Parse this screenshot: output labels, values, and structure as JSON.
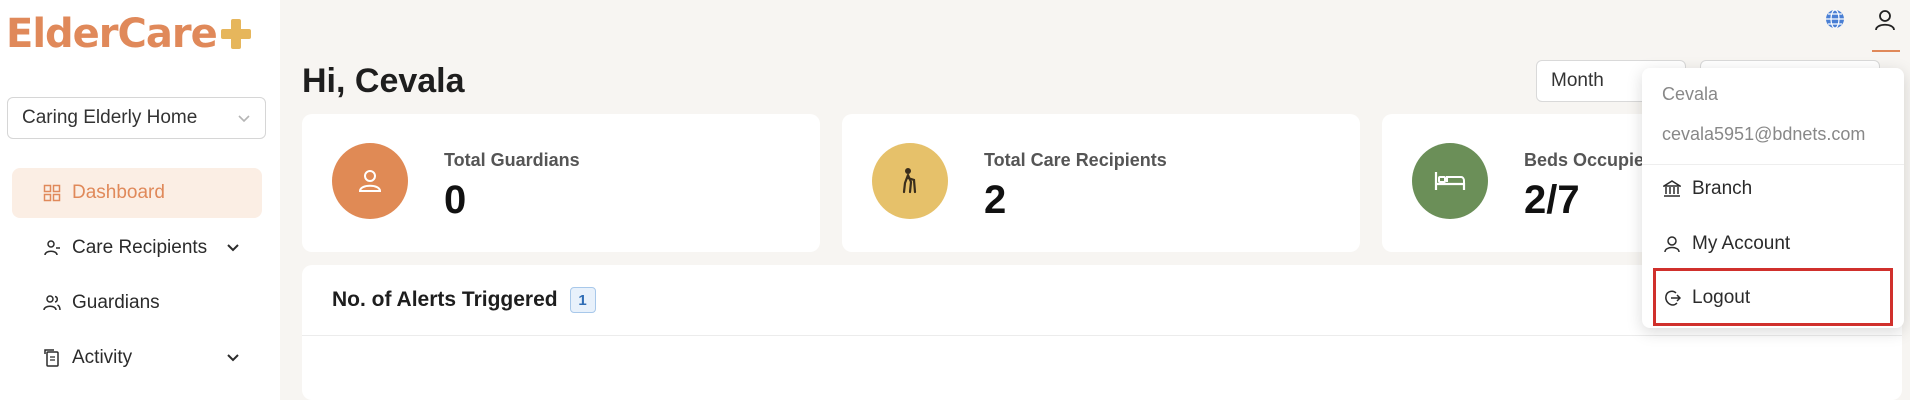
{
  "brand": {
    "logo_text": "ElderCare",
    "accent_color": "#e0895a",
    "plus_color": "#e6b65c"
  },
  "branch_select": {
    "value": "Caring Elderly Home",
    "icon": "chevron-down-icon"
  },
  "sidebar": {
    "items": [
      {
        "label": "Dashboard",
        "icon": "dashboard-icon",
        "active": true
      },
      {
        "label": "Care Recipients",
        "icon": "care-recipients-icon",
        "expandable": true
      },
      {
        "label": "Guardians",
        "icon": "guardians-icon"
      },
      {
        "label": "Activity",
        "icon": "activity-icon",
        "expandable": true
      }
    ]
  },
  "header": {
    "greeting": "Hi, Cevala",
    "globe_icon": "globe-icon",
    "user_icon": "user-icon"
  },
  "filters": {
    "period": "Month"
  },
  "stats": [
    {
      "label": "Total Guardians",
      "value": "0",
      "icon": "guardian-icon",
      "color": "#e08a55"
    },
    {
      "label": "Total Care Recipients",
      "value": "2",
      "icon": "elderly-person-icon",
      "color": "#e6c16a"
    },
    {
      "label": "Beds Occupied",
      "value": "2/7",
      "icon": "bed-icon",
      "color": "#6b8f58"
    }
  ],
  "alerts": {
    "title": "No. of Alerts Triggered",
    "count": "1"
  },
  "user_menu": {
    "name": "Cevala",
    "email": "cevala5951@bdnets.com",
    "items": [
      {
        "label": "Branch",
        "icon": "bank-icon"
      },
      {
        "label": "My Account",
        "icon": "user-icon"
      },
      {
        "label": "Logout",
        "icon": "logout-icon",
        "highlighted": true
      }
    ],
    "highlight_color": "#d0302c"
  }
}
